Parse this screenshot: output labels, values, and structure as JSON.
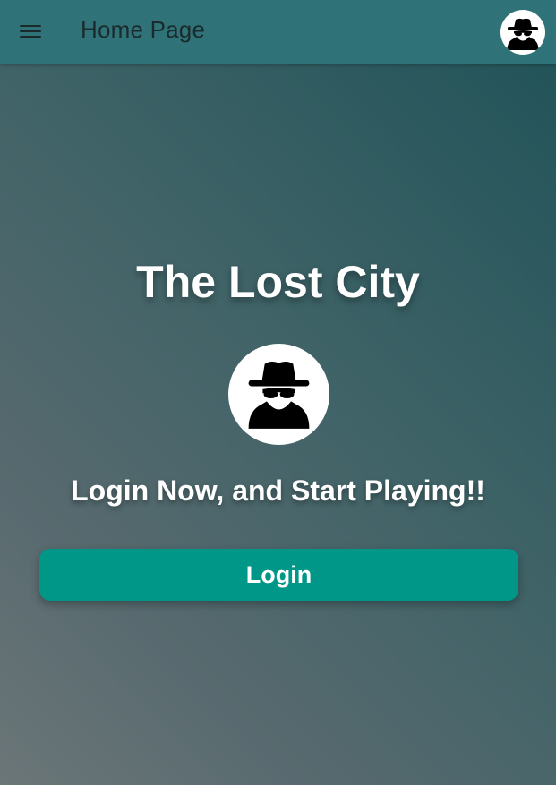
{
  "appbar": {
    "menu_icon": "menu-icon",
    "title": "Home Page",
    "avatar_icon": "spy-avatar-icon"
  },
  "main": {
    "headline": "The Lost City",
    "avatar_icon": "spy-avatar-icon",
    "subline": "Login Now, and Start Playing!!",
    "login_label": "Login"
  },
  "colors": {
    "appbar_bg": "#2f7378",
    "button_bg": "#009688",
    "text_light": "#ffffff",
    "text_dark": "#1b2b2d"
  }
}
